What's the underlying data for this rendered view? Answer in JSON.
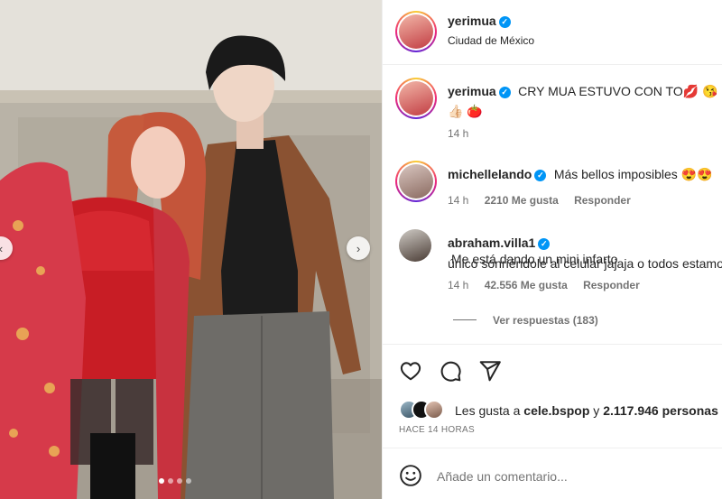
{
  "post": {
    "author": "yerimua",
    "location": "Ciudad de México"
  },
  "caption": {
    "username": "yerimua",
    "text": "CRY MUA ESTUVO CON TO💋 😘",
    "line2": "👍🏻 🍅",
    "time": "14 h"
  },
  "comments": [
    {
      "username": "michellelando",
      "text": "Más bellos imposibles 😍😍",
      "time": "14 h",
      "likes": "2210 Me gusta",
      "reply": "Responder"
    },
    {
      "username": "abraham.villa1",
      "text": "Me está dando un mini infarto",
      "line2": "único sonriéndole al celular jajaja o todos estamos",
      "time": "14 h",
      "likes": "42.556 Me gusta",
      "reply": "Responder",
      "replies_label": "Ver respuestas (183)"
    }
  ],
  "likes": {
    "prefix": "Les gusta a ",
    "user": "cele.bspop",
    "conj": " y ",
    "count": "2.117.946 personas"
  },
  "timestamp": "HACE 14 HORAS",
  "comment_input": {
    "placeholder": "Añade un comentario..."
  },
  "carousel": {
    "slides": 4,
    "active": 0
  },
  "icons": {
    "like": "heart-icon",
    "comment": "comment-bubble-icon",
    "share": "paper-plane-icon",
    "emoji": "smiley-icon",
    "verified": "verified-badge-icon"
  },
  "colors": {
    "verified": "#0095f6",
    "text": "#262626",
    "muted": "#737373"
  }
}
